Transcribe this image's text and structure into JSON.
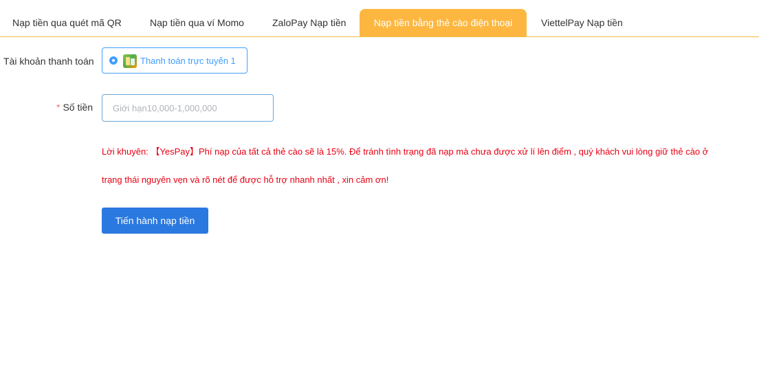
{
  "tabs": [
    {
      "label": "Nạp tiền qua quét mã QR"
    },
    {
      "label": "Nạp tiền qua ví Momo"
    },
    {
      "label": "ZaloPay Nạp tiền"
    },
    {
      "label": "Nạp tiền bằng thẻ cào điện thoại",
      "active": true
    },
    {
      "label": "ViettelPay Nạp tiền"
    }
  ],
  "form": {
    "account_label": "Tài khoản thanh toán",
    "account_option": "Thanh toán trực tuyến 1",
    "amount_required_mark": "*",
    "amount_label": "Số tiền",
    "amount_placeholder": "Giới hạn10,000-1,000,000",
    "amount_value": ""
  },
  "notice": {
    "line1": "Lời khuyên: 【YesPay】Phí nạp của tất cả thẻ cào sẽ là 15%. Để tránh tình trạng đã nạp mà chưa được xử lí lên điểm , quý khách vui lòng giữ thẻ cào ở",
    "line2": "trạng thái nguyên vẹn và rõ nét để được hỗ trợ nhanh nhất , xin cảm ơn!"
  },
  "submit_label": "Tiến hành nạp tiền",
  "colors": {
    "accent_tab": "#fdb740",
    "primary": "#2a79e0",
    "radio": "#409eff",
    "notice": "#e60012"
  },
  "icons": {
    "radio": "radio-checked-icon",
    "payment": "online-payment-icon"
  }
}
